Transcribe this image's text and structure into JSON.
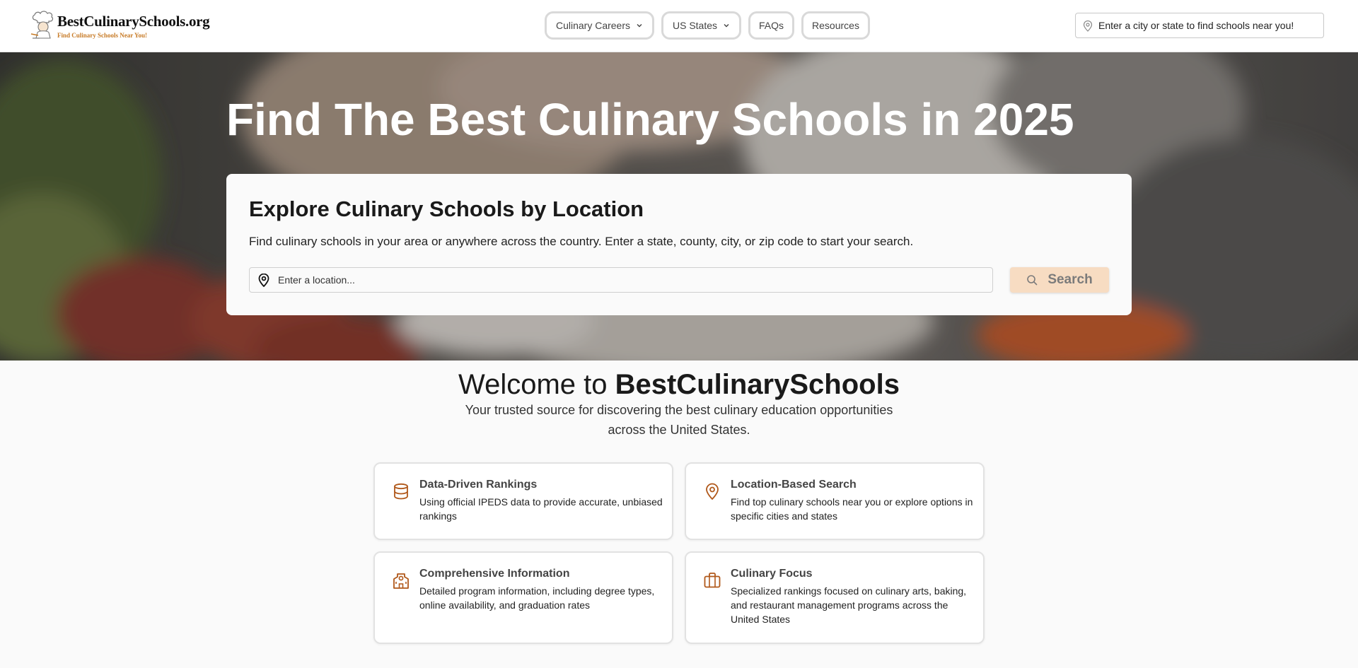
{
  "site": {
    "name": "BestCulinarySchools.org",
    "tagline": "Find Culinary Schools Near You!"
  },
  "nav": {
    "items": [
      {
        "label": "Culinary Careers",
        "dropdown": true
      },
      {
        "label": "US States",
        "dropdown": true
      },
      {
        "label": "FAQs",
        "dropdown": false
      },
      {
        "label": "Resources",
        "dropdown": false
      }
    ]
  },
  "header_search": {
    "placeholder": "Enter a city or state to find schools near you!"
  },
  "hero": {
    "title": "Find The Best Culinary Schools in 2025",
    "card": {
      "title": "Explore Culinary Schools by Location",
      "description": "Find culinary schools in your area or anywhere across the country. Enter a state, county, city, or zip code to start your search.",
      "input_placeholder": "Enter a location...",
      "button_label": "Search"
    }
  },
  "welcome": {
    "prefix": "Welcome to ",
    "brand": "BestCulinarySchools",
    "subtitle": "Your trusted source for discovering the best culinary education opportunities across the United States."
  },
  "features": [
    {
      "icon": "database-icon",
      "title": "Data-Driven Rankings",
      "description": "Using official IPEDS data to provide accurate, unbiased rankings"
    },
    {
      "icon": "map-pin-icon",
      "title": "Location-Based Search",
      "description": "Find top culinary schools near you or explore options in specific cities and states"
    },
    {
      "icon": "school-icon",
      "title": "Comprehensive Information",
      "description": "Detailed program information, including degree types, online availability, and graduation rates"
    },
    {
      "icon": "briefcase-icon",
      "title": "Culinary Focus",
      "description": "Specialized rankings focused on culinary arts, baking, and restaurant management programs across the United States"
    }
  ],
  "colors": {
    "accent": "#b0581a",
    "button_bg": "#f7dcc2",
    "logo_tagline": "#c77a25",
    "page_bg": "#fafafa"
  }
}
